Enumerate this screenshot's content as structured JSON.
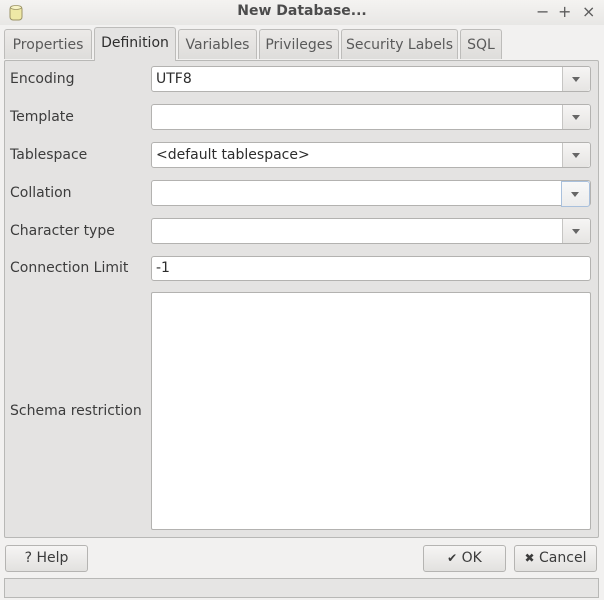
{
  "window": {
    "title": "New Database...",
    "icon": "database-icon",
    "controls": {
      "minimize": "−",
      "maximize": "+",
      "close": "×"
    }
  },
  "tabs": [
    {
      "label": "Properties",
      "active": false
    },
    {
      "label": "Definition",
      "active": true
    },
    {
      "label": "Variables",
      "active": false
    },
    {
      "label": "Privileges",
      "active": false
    },
    {
      "label": "Security Labels",
      "active": false
    },
    {
      "label": "SQL",
      "active": false
    }
  ],
  "form": {
    "encoding": {
      "label": "Encoding",
      "value": "UTF8"
    },
    "template": {
      "label": "Template",
      "value": ""
    },
    "tablespace": {
      "label": "Tablespace",
      "value": "<default tablespace>"
    },
    "collation": {
      "label": "Collation",
      "value": ""
    },
    "character_type": {
      "label": "Character type",
      "value": ""
    },
    "connection_limit": {
      "label": "Connection Limit",
      "value": "-1"
    },
    "schema_restriction": {
      "label": "Schema restriction",
      "value": ""
    }
  },
  "buttons": {
    "help": {
      "icon": "?",
      "label": "Help"
    },
    "ok": {
      "icon": "✔",
      "label": "OK"
    },
    "cancel": {
      "icon": "✖",
      "label": "Cancel"
    }
  },
  "status": {
    "text": ""
  }
}
